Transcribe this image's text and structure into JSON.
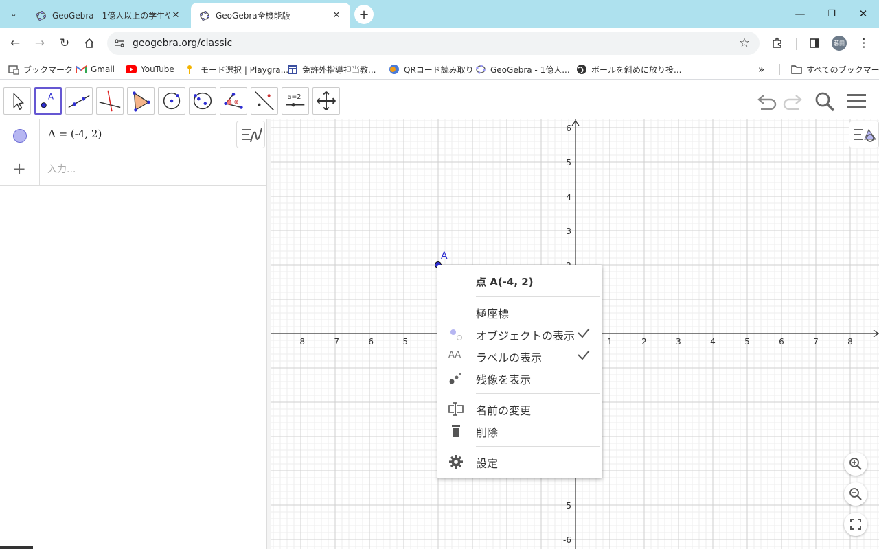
{
  "browser": {
    "tabs": [
      {
        "title": "GeoGebra - 1億人以上の学生や"
      },
      {
        "title": "GeoGebra全機能版"
      }
    ],
    "url": "geogebra.org/classic",
    "avatar_text": "藤田",
    "bookmarks": [
      {
        "label": "ブックマーク",
        "icon": "apps-icon"
      },
      {
        "label": "Gmail",
        "icon": "gmail-icon"
      },
      {
        "label": "YouTube",
        "icon": "youtube-icon"
      },
      {
        "label": "モード選択 | Playgra...",
        "icon": "playground-icon"
      },
      {
        "label": "免許外指導担当教...",
        "icon": "form-icon"
      },
      {
        "label": "QRコード読み取り",
        "icon": "qr-icon"
      },
      {
        "label": "GeoGebra - 1億人...",
        "icon": "geogebra-icon"
      },
      {
        "label": "ボールを斜めに放り投...",
        "icon": "globe-icon"
      }
    ],
    "all_bookmarks": "すべてのブックマーク",
    "more": "»"
  },
  "algebra": {
    "rows": [
      {
        "text": "A = (-4, 2)"
      }
    ],
    "input_placeholder": "入力..."
  },
  "graphics": {
    "x_ticks": [
      "-8",
      "-7",
      "-6",
      "-5",
      "-4",
      "1",
      "2",
      "3",
      "4",
      "5",
      "6",
      "7",
      "8"
    ],
    "y_ticks": [
      "6",
      "5",
      "4",
      "3",
      "2",
      "-5",
      "-6"
    ],
    "point": {
      "label": "A",
      "x": -4,
      "y": 2,
      "color": "#2e2ed1"
    }
  },
  "context_menu": {
    "title": "点 A(-4, 2)",
    "items": [
      {
        "label": "極座標",
        "icon": "",
        "checked": false
      },
      {
        "label": "オブジェクトの表示",
        "icon": "show-object-icon",
        "checked": true
      },
      {
        "label": "ラベルの表示",
        "icon": "show-label-icon",
        "checked": true
      },
      {
        "label": "残像を表示",
        "icon": "trace-icon",
        "checked": false
      },
      {
        "label": "名前の変更",
        "icon": "rename-icon",
        "checked": false
      },
      {
        "label": "削除",
        "icon": "trash-icon",
        "checked": false
      },
      {
        "label": "設定",
        "icon": "gear-icon",
        "checked": false
      }
    ]
  },
  "colors": {
    "accent": "#6557d2",
    "point": "#2e2ed1",
    "tab_bar": "#aee1ee"
  }
}
